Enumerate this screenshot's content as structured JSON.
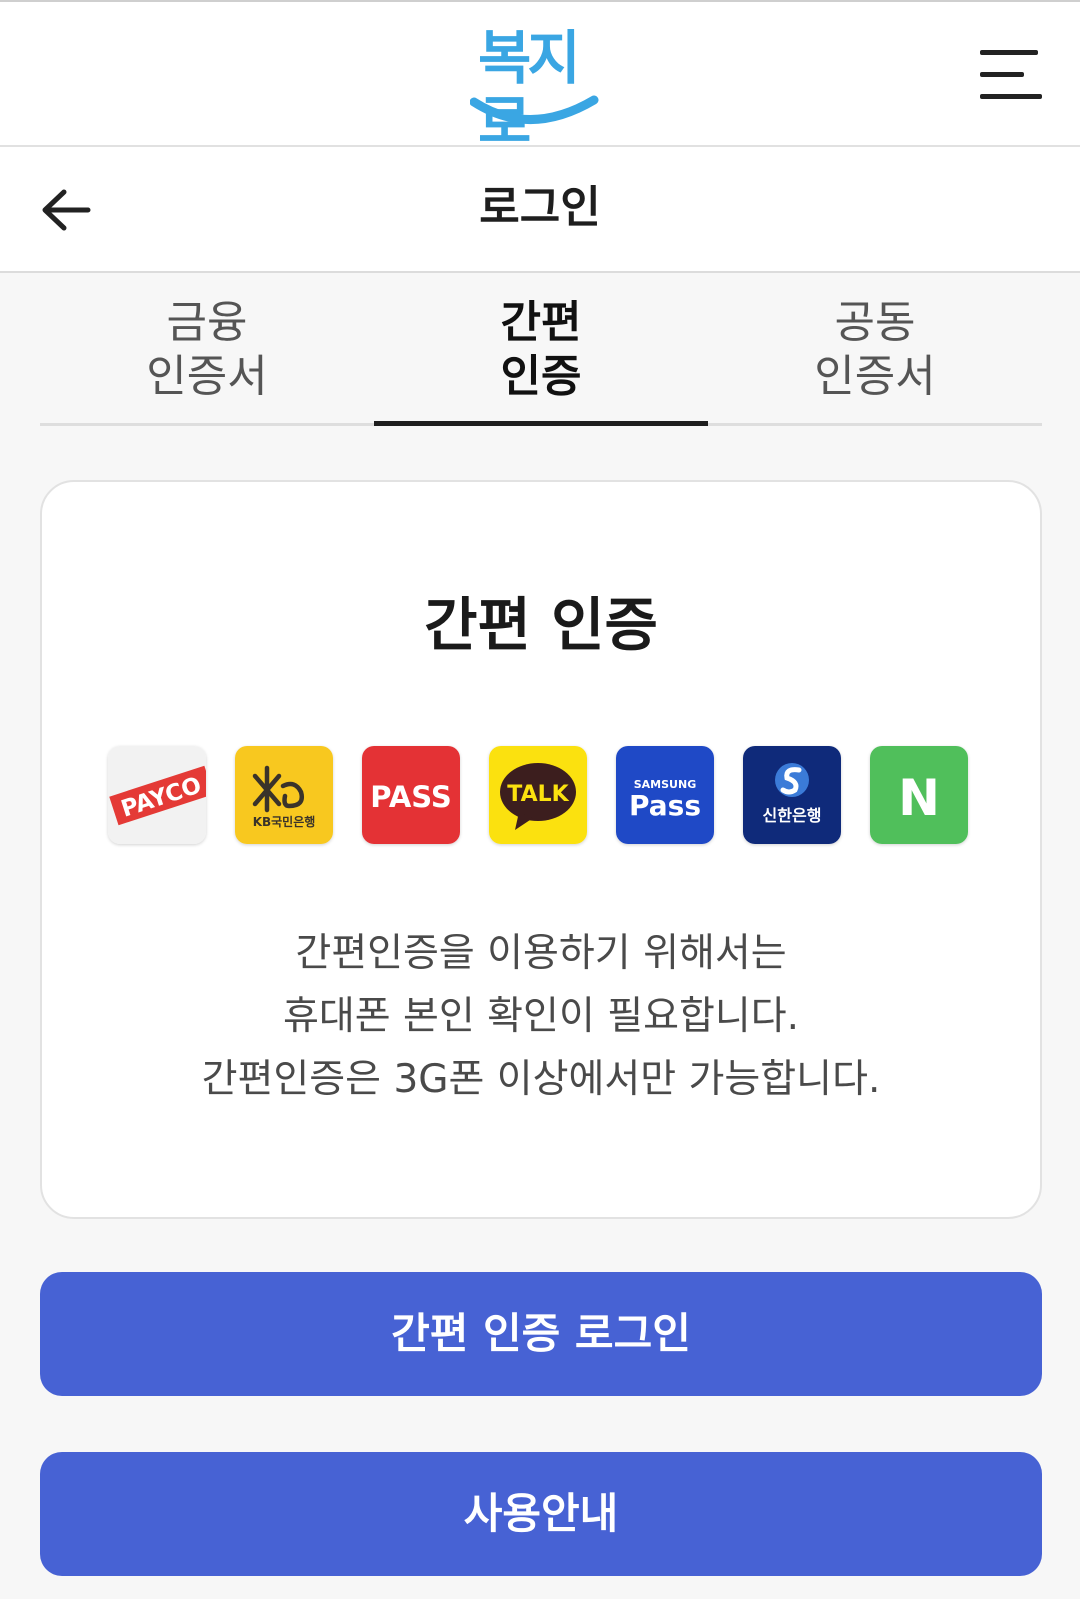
{
  "header": {
    "logo_text": "복지로",
    "menu_icon": "hamburger-menu-icon"
  },
  "titlebar": {
    "back_icon": "arrow-left-icon",
    "title": "로그인"
  },
  "tabs": [
    {
      "line1": "금융",
      "line2": "인증서",
      "active": false
    },
    {
      "line1": "간편",
      "line2": "인증",
      "active": true
    },
    {
      "line1": "공동",
      "line2": "인증서",
      "active": false
    }
  ],
  "card": {
    "title": "간편 인증",
    "providers": [
      {
        "label": "PAYCO",
        "icon": "payco-icon"
      },
      {
        "label": "KB국민은행",
        "icon": "kb-bank-icon"
      },
      {
        "label": "PASS",
        "icon": "pass-icon"
      },
      {
        "label": "TALK",
        "icon": "kakao-talk-icon"
      },
      {
        "label_top": "SAMSUNG",
        "label": "Pass",
        "icon": "samsung-pass-icon"
      },
      {
        "label": "신한은행",
        "icon": "shinhan-bank-icon"
      },
      {
        "label": "N",
        "icon": "naver-icon"
      }
    ],
    "notice": [
      "간편인증을 이용하기 위해서는",
      "휴대폰 본인 확인이 필요합니다.",
      "간편인증은 3G폰 이상에서만 가능합니다."
    ]
  },
  "buttons": {
    "login": "간편 인증 로그인",
    "guide": "사용안내"
  },
  "colors": {
    "primary": "#4762d4",
    "logo": "#3aa6e3"
  }
}
